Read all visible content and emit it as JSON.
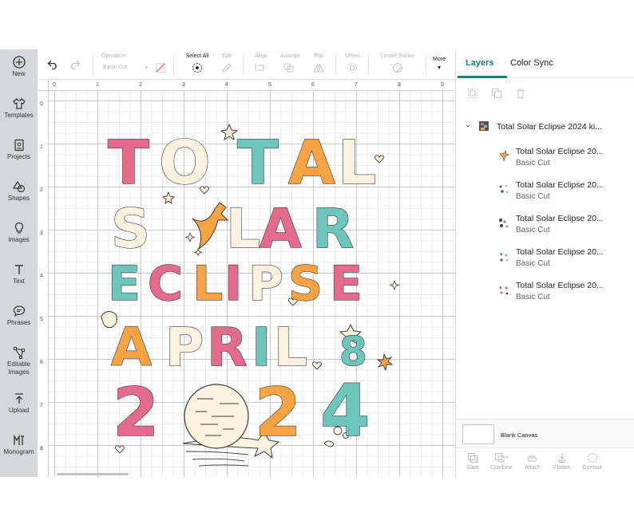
{
  "sidebar": {
    "items": [
      {
        "label": "New",
        "icon": "plus-circle-icon"
      },
      {
        "label": "Templates",
        "icon": "shirt-icon"
      },
      {
        "label": "Projects",
        "icon": "projects-icon"
      },
      {
        "label": "Shapes",
        "icon": "shapes-icon"
      },
      {
        "label": "Images",
        "icon": "lightbulb-icon"
      },
      {
        "label": "Text",
        "icon": "text-t-icon"
      },
      {
        "label": "Phrases",
        "icon": "speech-bubble-icon"
      },
      {
        "label": "Editable Images",
        "icon": "editable-image-icon"
      },
      {
        "label": "Upload",
        "icon": "upload-icon"
      },
      {
        "label": "Monogram",
        "icon": "monogram-icon"
      }
    ]
  },
  "toolbar": {
    "operation_label": "Operation",
    "operation_value": "Basic Cut",
    "select_all_label": "Select All",
    "edit_label": "Edit",
    "align_label": "Align",
    "arrange_label": "Arrange",
    "flip_label": "Flip",
    "offset_label": "Offset",
    "create_sticker_label": "Create Sticker",
    "more_label": "More"
  },
  "ruler": {
    "top": [
      "0",
      "1",
      "2",
      "3",
      "4",
      "5",
      "6",
      "7",
      "8",
      "9"
    ],
    "left": [
      "0",
      "1",
      "2",
      "3",
      "4",
      "5",
      "6",
      "7",
      "8"
    ]
  },
  "artwork": {
    "lines": [
      "TOTAL",
      "S  LAR",
      "ECLIPSE",
      "APRIL 8",
      "2024"
    ],
    "colors": {
      "pink": "#e66a8c",
      "teal": "#6cc6bb",
      "orange": "#f6a443",
      "cream": "#fbf2df",
      "outline": "#3d3d3d"
    }
  },
  "panel": {
    "tabs": [
      "Layers",
      "Color Sync"
    ],
    "accent": "#1e7f74",
    "group_name": "Total Solar Eclipse 2024 ki...",
    "layers": [
      {
        "name": "Total Solar Eclipse 20...",
        "op": "Basic Cut"
      },
      {
        "name": "Total Solar Eclipse 20...",
        "op": "Basic Cut"
      },
      {
        "name": "Total Solar Eclipse 20...",
        "op": "Basic Cut"
      },
      {
        "name": "Total Solar Eclipse 20...",
        "op": "Basic Cut"
      },
      {
        "name": "Total Solar Eclipse 20...",
        "op": "Basic Cut"
      }
    ],
    "canvas_label": "Blank Canvas",
    "actions": [
      "Slice",
      "Combine",
      "Attach",
      "Flatten",
      "Contour"
    ]
  }
}
